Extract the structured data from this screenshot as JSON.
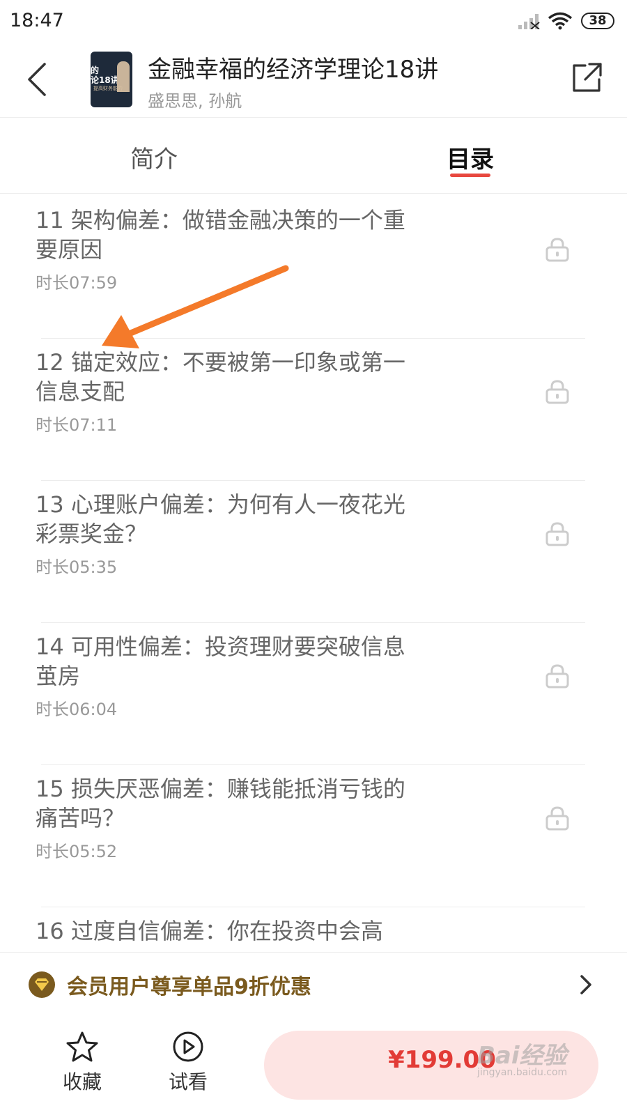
{
  "status_bar": {
    "time": "18:47",
    "battery": "38"
  },
  "header": {
    "title": "金融幸福的经济学理论18讲",
    "authors": "盛思思, 孙航",
    "cover_text": "的\n论18讲",
    "cover_subtext": "提高财务能力"
  },
  "tabs": [
    {
      "label": "简介",
      "active": false
    },
    {
      "label": "目录",
      "active": true
    }
  ],
  "episodes": [
    {
      "title": "11 架构偏差：做错金融决策的一个重要原因",
      "duration": "时长07:59",
      "locked": true
    },
    {
      "title": "12 锚定效应：不要被第一印象或第一信息支配",
      "duration": "时长07:11",
      "locked": true
    },
    {
      "title": "13 心理账户偏差：为何有人一夜花光彩票奖金？",
      "duration": "时长05:35",
      "locked": true
    },
    {
      "title": "14 可用性偏差：投资理财要突破信息茧房",
      "duration": "时长06:04",
      "locked": true
    },
    {
      "title": "15 损失厌恶偏差：赚钱能抵消亏钱的痛苦吗？",
      "duration": "时长05:52",
      "locked": true
    },
    {
      "title": "16 过度自信偏差：你在投资中会高",
      "duration": "",
      "locked": true
    }
  ],
  "member_bar": {
    "text": "会员用户尊享单品9折优惠"
  },
  "bottom_bar": {
    "favorite_label": "收藏",
    "trial_label": "试看",
    "price": "¥199.00"
  },
  "watermark": {
    "brand": "Bai经验",
    "url": "jingyan.baidu.com"
  },
  "colors": {
    "accent": "#e8483f",
    "price": "#e23b36",
    "member": "#7a5a1e",
    "annotation_arrow": "#f47a2a"
  }
}
